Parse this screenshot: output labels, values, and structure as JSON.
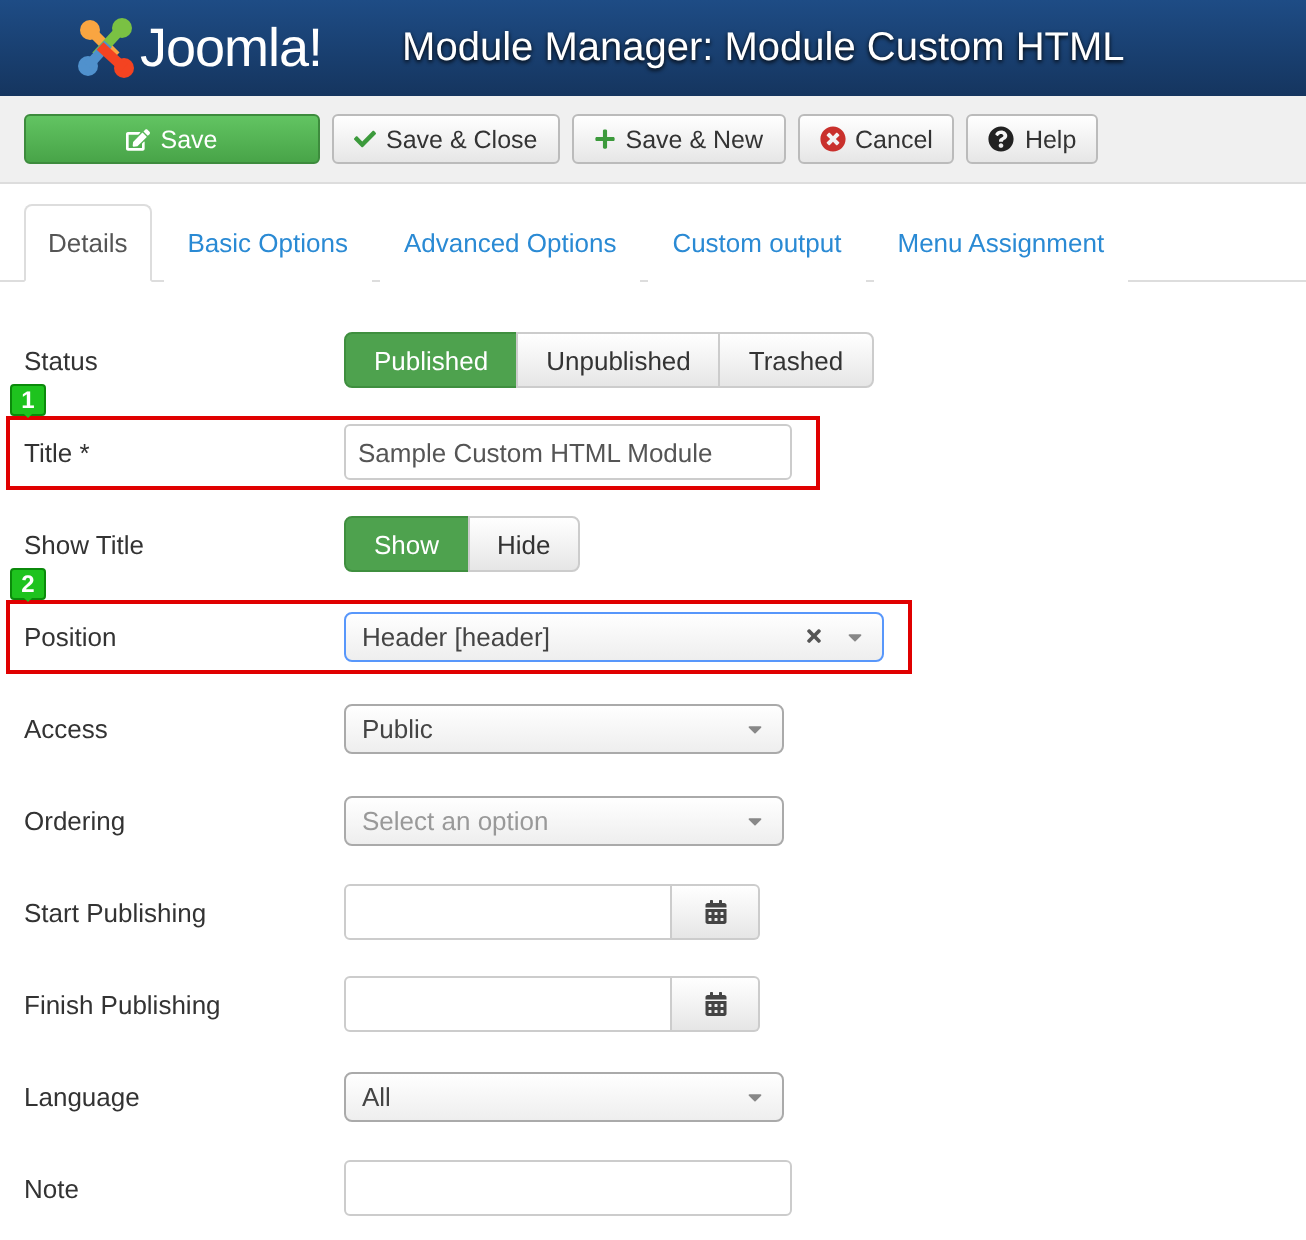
{
  "header": {
    "logo_text": "Joomla!",
    "title": "Module Manager: Module Custom HTML"
  },
  "toolbar": [
    {
      "label": "Save",
      "kind": "primary"
    },
    {
      "label": "Save & Close",
      "kind": "check"
    },
    {
      "label": "Save & New",
      "kind": "plus"
    },
    {
      "label": "Cancel",
      "kind": "cancel"
    },
    {
      "label": "Help",
      "kind": "help"
    }
  ],
  "tabs": [
    {
      "label": "Details",
      "selected": true
    },
    {
      "label": "Basic Options",
      "selected": false
    },
    {
      "label": "Advanced Options",
      "selected": false
    },
    {
      "label": "Custom output",
      "selected": false
    },
    {
      "label": "Menu Assignment",
      "selected": false
    }
  ],
  "fields": [
    {
      "label": "Status",
      "kind": "toggle",
      "options": [
        {
          "label": "Published",
          "selected": true
        },
        {
          "label": "Unpublished",
          "selected": false
        },
        {
          "label": "Trashed",
          "selected": false
        }
      ]
    },
    {
      "label": "Title *",
      "kind": "text",
      "value": "Sample Custom HTML Module",
      "highlighted": true,
      "callout": "1"
    },
    {
      "label": "Show Title",
      "kind": "toggle",
      "options": [
        {
          "label": "Show",
          "selected": true
        },
        {
          "label": "Hide",
          "selected": false
        }
      ]
    },
    {
      "label": "Position",
      "kind": "select",
      "value": "Header [header]",
      "clearable": true,
      "focused": true,
      "highlighted": true,
      "callout": "2"
    },
    {
      "label": "Access",
      "kind": "select",
      "value": "Public"
    },
    {
      "label": "Ordering",
      "kind": "select",
      "placeholder": "Select an option"
    },
    {
      "label": "Start Publishing",
      "kind": "date"
    },
    {
      "label": "Finish Publishing",
      "kind": "date"
    },
    {
      "label": "Language",
      "kind": "select",
      "value": "All"
    },
    {
      "label": "Note",
      "kind": "text"
    }
  ]
}
